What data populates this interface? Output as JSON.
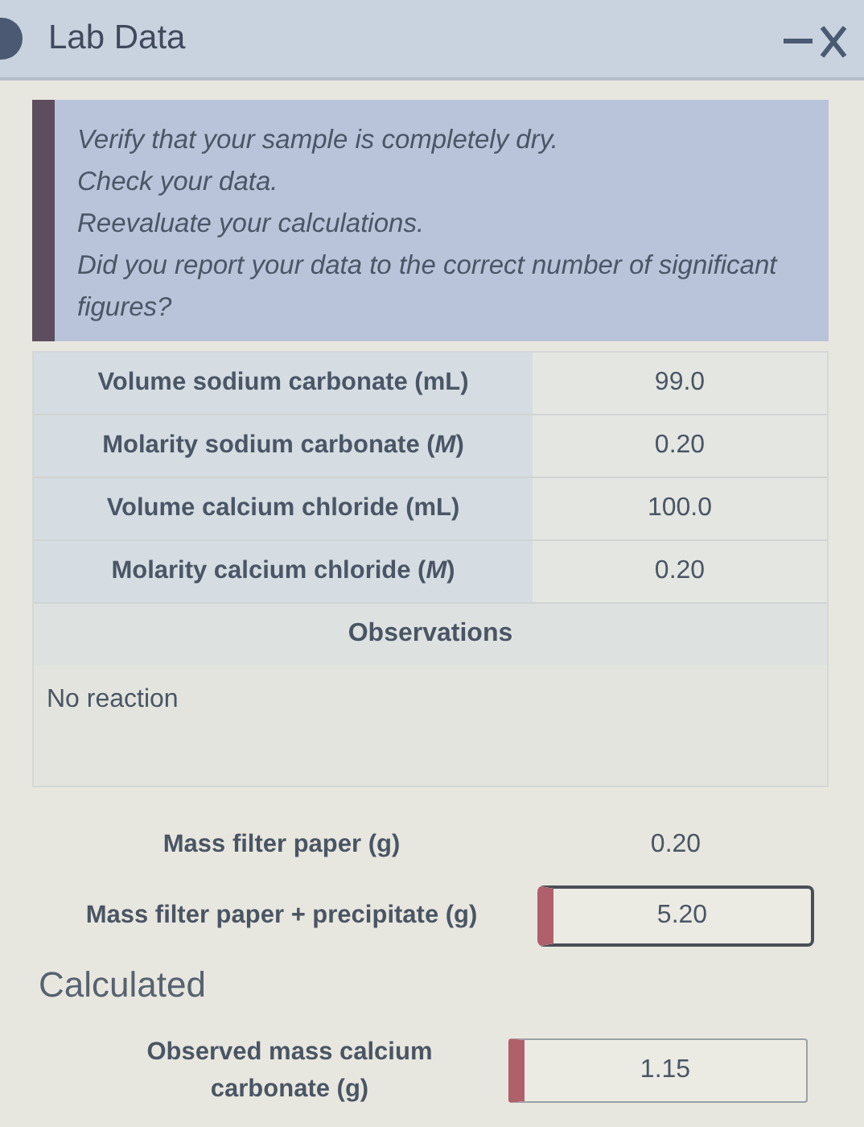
{
  "window": {
    "title": "Lab Data"
  },
  "feedback": [
    "Verify that your sample is completely dry.",
    "Check your data.",
    "Reevaluate your calculations.",
    "Did you report your data to the correct number of significant figures?"
  ],
  "given": [
    {
      "label": "Volume sodium carbonate (mL)",
      "value": "99.0"
    },
    {
      "label": "Molarity sodium carbonate (*M*)",
      "value": "0.20"
    },
    {
      "label": "Volume calcium chloride (mL)",
      "value": "100.0"
    },
    {
      "label": "Molarity calcium chloride (*M*)",
      "value": "0.20"
    }
  ],
  "observations": {
    "heading": "Observations",
    "text": "No reaction"
  },
  "measured": [
    {
      "kind": "value",
      "label": "Mass filter paper (g)",
      "value": "0.20"
    },
    {
      "kind": "input",
      "label": "Mass filter paper + precipitate (g)",
      "value": "5.20",
      "invalid": true,
      "focused": true
    }
  ],
  "calculated": {
    "heading": "Calculated",
    "rows": [
      {
        "kind": "input",
        "label": "Observed mass calcium carbonate (g)",
        "value": "1.15",
        "invalid": true,
        "focused": false
      }
    ]
  }
}
